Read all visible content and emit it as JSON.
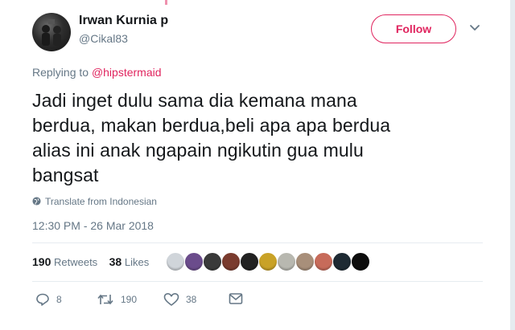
{
  "user": {
    "name": "Irwan Kurnia p",
    "handle": "@Cikal83"
  },
  "follow_label": "Follow",
  "reply_context": {
    "prefix": "Replying to",
    "mention": "@hipstermaid"
  },
  "tweet": {
    "text_lines": [
      "Jadi inget dulu sama dia kemana mana",
      "berdua, makan berdua,beli apa apa berdua",
      "alias ini anak ngapain ngikutin gua mulu",
      "bangsat"
    ],
    "translate_label": "Translate from Indonesian",
    "timestamp": "12:30 PM - 26 Mar 2018"
  },
  "stats": {
    "retweets_count": "190",
    "retweets_label": "Retweets",
    "likes_count": "38",
    "likes_label": "Likes"
  },
  "likers": [
    {
      "color": "#d0d5da"
    },
    {
      "color": "#6b4c8c"
    },
    {
      "color": "#3a3a3a"
    },
    {
      "color": "#7a3b2e"
    },
    {
      "color": "#222222"
    },
    {
      "color": "#c9a227"
    },
    {
      "color": "#b8b8b0"
    },
    {
      "color": "#a88f7a"
    },
    {
      "color": "#c76b5a"
    },
    {
      "color": "#1e2a33"
    },
    {
      "color": "#0d0d0d"
    }
  ],
  "actions": {
    "reply_count": "8",
    "retweet_count": "190",
    "like_count": "38"
  },
  "colors": {
    "accent": "#e0245e",
    "muted": "#657786",
    "text": "#14171a",
    "divider": "#e6ecf0"
  }
}
